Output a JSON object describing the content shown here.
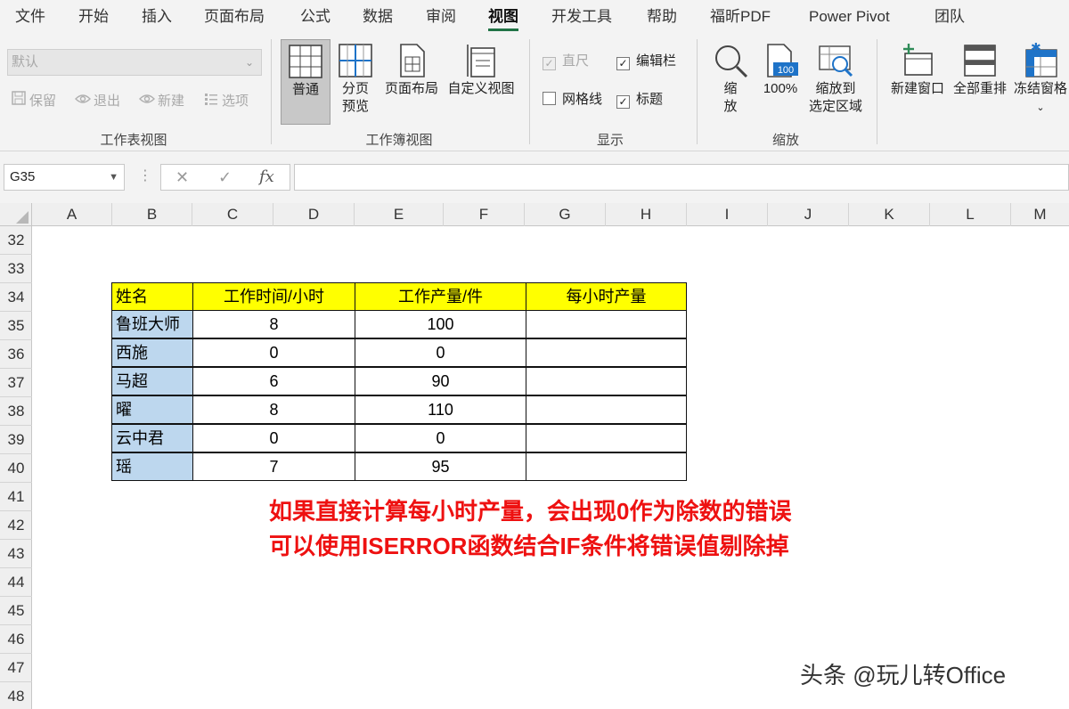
{
  "menu": {
    "items": [
      "文件",
      "开始",
      "插入",
      "页面布局",
      "公式",
      "数据",
      "审阅",
      "视图",
      "开发工具",
      "帮助",
      "福昕PDF",
      "Power Pivot",
      "团队"
    ],
    "active": "视图"
  },
  "ribbon": {
    "sheet_view": {
      "select_value": "默认",
      "keep": "保留",
      "exit": "退出",
      "new": "新建",
      "options": "选项",
      "label": "工作表视图"
    },
    "workbook_views": {
      "normal": "普通",
      "page_break_line1": "分页",
      "page_break_line2": "预览",
      "page_layout": "页面布局",
      "custom_views": "自定义视图",
      "label": "工作簿视图"
    },
    "show": {
      "ruler": "直尺",
      "formula_bar": "编辑栏",
      "gridlines": "网格线",
      "headings": "标题",
      "label": "显示"
    },
    "zoom": {
      "zoom_line1": "缩",
      "zoom_line2": "放",
      "hundred": "100%",
      "hundred_icon": "100",
      "selection_line1": "缩放到",
      "selection_line2": "选定区域",
      "label": "缩放"
    },
    "window": {
      "new_window": "新建窗口",
      "arrange_all": "全部重排",
      "freeze_panes": "冻结窗格"
    }
  },
  "formula_bar": {
    "name_box": "G35",
    "cancel": "✕",
    "enter": "✓",
    "fx": "fx",
    "formula": ""
  },
  "grid": {
    "columns": [
      "A",
      "B",
      "C",
      "D",
      "E",
      "F",
      "G",
      "H",
      "I",
      "J",
      "K",
      "L",
      "M"
    ],
    "rows": [
      "32",
      "33",
      "34",
      "35",
      "36",
      "37",
      "38",
      "39",
      "40",
      "41",
      "42",
      "43",
      "44",
      "45",
      "46",
      "47",
      "48"
    ]
  },
  "table": {
    "headers": [
      "姓名",
      "工作时间/小时",
      "工作产量/件",
      "每小时产量"
    ],
    "rows": [
      {
        "name": "鲁班大师",
        "hours": "8",
        "output": "100",
        "per_hour": ""
      },
      {
        "name": "西施",
        "hours": "0",
        "output": "0",
        "per_hour": ""
      },
      {
        "name": "马超",
        "hours": "6",
        "output": "90",
        "per_hour": ""
      },
      {
        "name": "曜",
        "hours": "8",
        "output": "110",
        "per_hour": ""
      },
      {
        "name": "云中君",
        "hours": "0",
        "output": "0",
        "per_hour": ""
      },
      {
        "name": "瑶",
        "hours": "7",
        "output": "95",
        "per_hour": ""
      }
    ]
  },
  "notes": {
    "line1": "如果直接计算每小时产量，会出现0作为除数的错误",
    "line2": "可以使用ISERROR函数结合IF条件将错误值剔除掉"
  },
  "watermark": "头条 @玩儿转Office",
  "colors": {
    "header_fill": "#ffff00",
    "name_fill": "#bdd7ee",
    "note_text": "#ee1111",
    "accent": "#217346"
  }
}
